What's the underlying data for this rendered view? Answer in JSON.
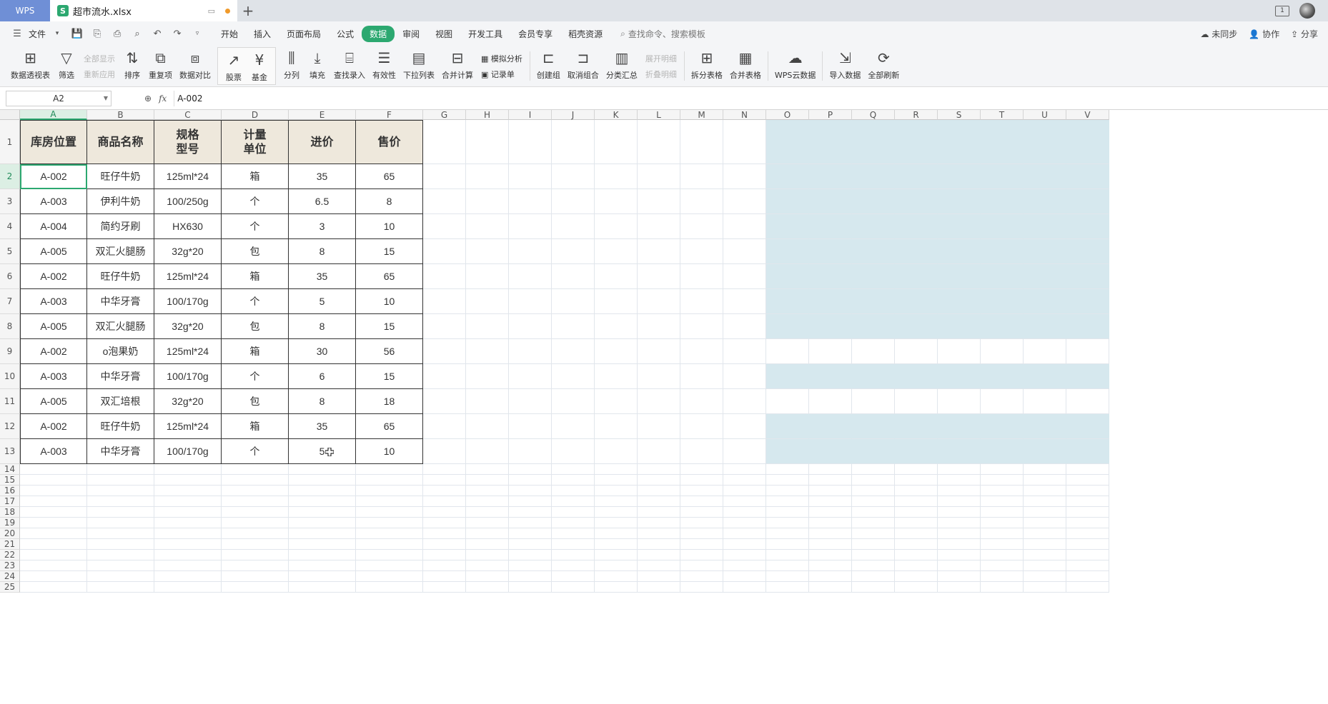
{
  "titlebar": {
    "app_tab": "WPS",
    "file_tab": "超市流水.xlsx",
    "file_icon": "S"
  },
  "menubar": {
    "file_label": "文件",
    "items": [
      "开始",
      "插入",
      "页面布局",
      "公式",
      "数据",
      "审阅",
      "视图",
      "开发工具",
      "会员专享",
      "稻壳资源"
    ],
    "active_index": 4,
    "search_label": "查找命令、搜索模板",
    "right": [
      "未同步",
      "协作",
      "分享"
    ]
  },
  "ribbon": {
    "pivot": "数据透视表",
    "filter": "筛选",
    "show_all": "全部显示",
    "reapply": "重新应用",
    "sort": "排序",
    "duplicates": "重复项",
    "compare": "数据对比",
    "stock": "股票",
    "fund": "基金",
    "split": "分列",
    "fill": "填充",
    "lookup": "查找录入",
    "validity": "有效性",
    "dropdown": "下拉列表",
    "merge_calc": "合并计算",
    "simulate": "模拟分析",
    "record": "记录单",
    "create_group": "创建组",
    "ungroup": "取消组合",
    "subtotal": "分类汇总",
    "expand": "展开明细",
    "collapse": "折叠明细",
    "split_table": "拆分表格",
    "merge_table": "合并表格",
    "wps_cloud": "WPS云数据",
    "import": "导入数据",
    "refresh_all": "全部刷新"
  },
  "formulabar": {
    "name_box": "A2",
    "fx": "fx",
    "formula": "A-002"
  },
  "sheet": {
    "columns": [
      "A",
      "B",
      "C",
      "D",
      "E",
      "F",
      "G",
      "H",
      "I",
      "J",
      "K",
      "L",
      "M",
      "N",
      "O",
      "P",
      "Q",
      "R",
      "S",
      "T",
      "U",
      "V"
    ],
    "selected_column": "A",
    "selected_row": 2,
    "headers": [
      "库房位置",
      "商品名称",
      "规格\n型号",
      "计量\n单位",
      "进价",
      "售价"
    ],
    "rows": [
      [
        "A-002",
        "旺仔牛奶",
        "125ml*24",
        "箱",
        "35",
        "65"
      ],
      [
        "A-003",
        "伊利牛奶",
        "100/250g",
        "个",
        "6.5",
        "8"
      ],
      [
        "A-004",
        "简约牙刷",
        "HX630",
        "个",
        "3",
        "10"
      ],
      [
        "A-005",
        "双汇火腿肠",
        "32g*20",
        "包",
        "8",
        "15"
      ],
      [
        "A-002",
        "旺仔牛奶",
        "125ml*24",
        "箱",
        "35",
        "65"
      ],
      [
        "A-003",
        "中华牙膏",
        "100/170g",
        "个",
        "5",
        "10"
      ],
      [
        "A-005",
        "双汇火腿肠",
        "32g*20",
        "包",
        "8",
        "15"
      ],
      [
        "A-002",
        "o泡果奶",
        "125ml*24",
        "箱",
        "30",
        "56"
      ],
      [
        "A-003",
        "中华牙膏",
        "100/170g",
        "个",
        "6",
        "15"
      ],
      [
        "A-005",
        "双汇培根",
        "32g*20",
        "包",
        "8",
        "18"
      ],
      [
        "A-002",
        "旺仔牛奶",
        "125ml*24",
        "箱",
        "35",
        "65"
      ],
      [
        "A-003",
        "中华牙膏",
        "100/170g",
        "个",
        "5",
        "10"
      ]
    ],
    "row_numbers": [
      "1",
      "2",
      "3",
      "4",
      "5",
      "6",
      "7",
      "8",
      "9",
      "10",
      "11",
      "12",
      "13",
      "14",
      "15",
      "16",
      "17",
      "18",
      "19",
      "20",
      "21",
      "22",
      "23",
      "24",
      "25"
    ]
  }
}
